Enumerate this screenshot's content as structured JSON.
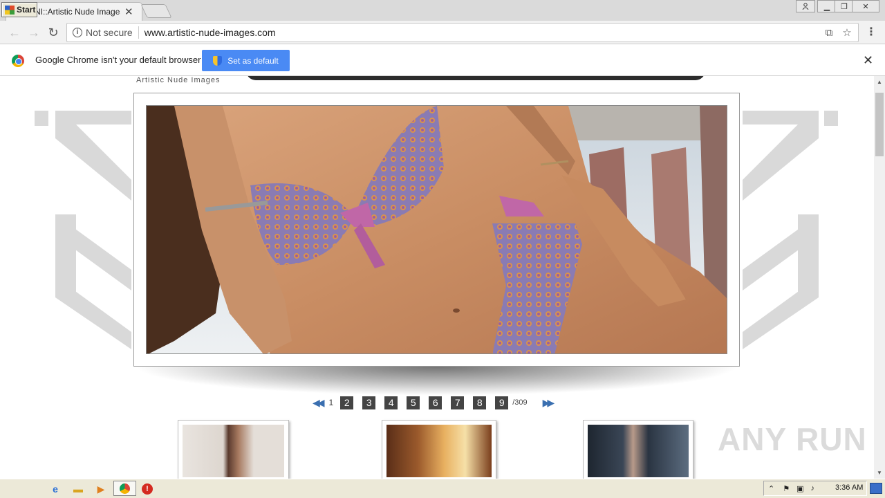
{
  "browser": {
    "tab_title": "ANI::Artistic Nude Images::",
    "tab_favicon": "K",
    "security_label": "Not secure",
    "url": "www.artistic-nude-images.com"
  },
  "infobar": {
    "message": "Google Chrome isn't your default browser",
    "set_default_label": "Set as default"
  },
  "page": {
    "site_name": "Artistic Nude Images",
    "pagination": {
      "current": "1",
      "pages": [
        "2",
        "3",
        "4",
        "5",
        "6",
        "7",
        "8",
        "9"
      ],
      "total": "/309"
    }
  },
  "watermark": "ANY RUN",
  "taskbar": {
    "start_label": "Start",
    "clock": "3:36 AM"
  }
}
